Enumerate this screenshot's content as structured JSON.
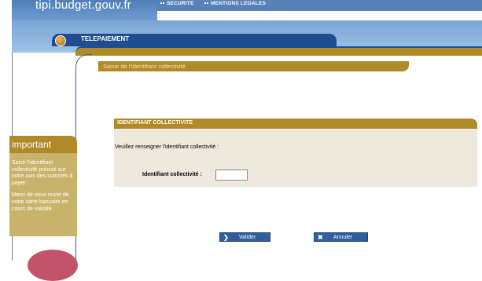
{
  "header": {
    "site_name": "tipi.budget.gouv.fr",
    "nav": [
      "SECURITE",
      "MENTIONS LEGALES"
    ]
  },
  "banner": {
    "section_title": "TELEPAIEMENT"
  },
  "breadcrumb": {
    "text": "Saisie de l'identifiant collectivité"
  },
  "important": {
    "title": "important",
    "paragraphs": [
      "Saisir l'identifiant collectivité précisé sur votre avis des sommes à payer.",
      "Merci de vous munir de votre carte bancaire en cours de validité."
    ]
  },
  "form": {
    "header": "IDENTIFIANT COLLECTIVITE",
    "instruction": "Veuillez renseigner l'identifiant collectivité :",
    "field_label": "Identifiant collectivité :",
    "field_value": ""
  },
  "buttons": {
    "valider": {
      "label": "Valider",
      "icon": "arrow-right-icon"
    },
    "annuler": {
      "label": "Annuler",
      "icon": "close-x-icon"
    }
  },
  "colors": {
    "navy": "#1f4d8f",
    "gold": "#b08a28",
    "khaki": "#c9b36a",
    "panel_bg": "#efe9dd",
    "button_blue": "#2f5f9e"
  }
}
